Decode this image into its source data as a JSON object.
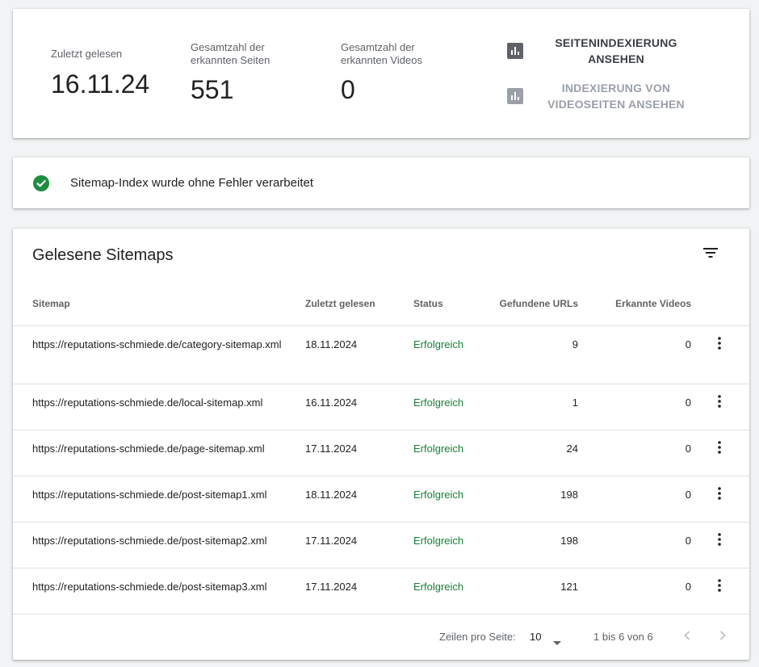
{
  "summary": {
    "last_read_label": "Zuletzt gelesen",
    "last_read_value": "16.11.24",
    "pages_label": "Gesamtzahl der erkannten Seiten",
    "pages_value": "551",
    "videos_label": "Gesamtzahl der erkannten Videos",
    "videos_value": "0",
    "page_index_button": "SEITENINDEXIERUNG ANSEHEN",
    "video_index_button": "INDEXIERUNG VON VIDEOSEITEN ANSEHEN"
  },
  "status": {
    "message": "Sitemap-Index wurde ohne Fehler verarbeitet",
    "color": "#1e8e3e"
  },
  "table": {
    "title": "Gelesene Sitemaps",
    "columns": [
      "Sitemap",
      "Zuletzt gelesen",
      "Status",
      "Gefundene URLs",
      "Erkannte Videos"
    ],
    "rows": [
      {
        "sitemap": "https://reputations-schmiede.de/category-sitemap.xml",
        "date": "18.11.2024",
        "status": "Erfolgreich",
        "urls": "9",
        "videos": "0"
      },
      {
        "sitemap": "https://reputations-schmiede.de/local-sitemap.xml",
        "date": "16.11.2024",
        "status": "Erfolgreich",
        "urls": "1",
        "videos": "0"
      },
      {
        "sitemap": "https://reputations-schmiede.de/page-sitemap.xml",
        "date": "17.11.2024",
        "status": "Erfolgreich",
        "urls": "24",
        "videos": "0"
      },
      {
        "sitemap": "https://reputations-schmiede.de/post-sitemap1.xml",
        "date": "18.11.2024",
        "status": "Erfolgreich",
        "urls": "198",
        "videos": "0"
      },
      {
        "sitemap": "https://reputations-schmiede.de/post-sitemap2.xml",
        "date": "17.11.2024",
        "status": "Erfolgreich",
        "urls": "198",
        "videos": "0"
      },
      {
        "sitemap": "https://reputations-schmiede.de/post-sitemap3.xml",
        "date": "17.11.2024",
        "status": "Erfolgreich",
        "urls": "121",
        "videos": "0"
      }
    ],
    "status_color": "#188038"
  },
  "pagination": {
    "rows_per_page_label": "Zeilen pro Seite:",
    "rows_per_page_value": "10",
    "range_text": "1 bis 6 von 6"
  },
  "icons": {
    "report": "bar-chart-icon",
    "status": "check-circle-icon",
    "filter": "filter-icon",
    "row_menu": "more-vert-icon",
    "dropdown": "caret-down-icon",
    "prev": "chevron-left-icon",
    "next": "chevron-right-icon"
  }
}
